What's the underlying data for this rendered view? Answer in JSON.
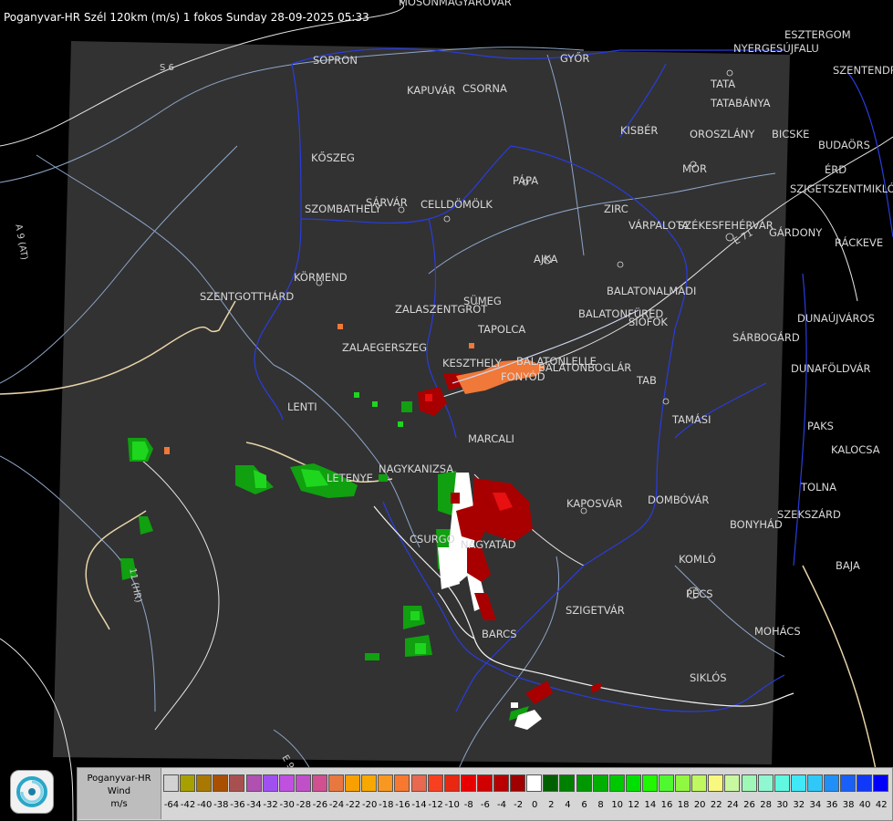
{
  "header": {
    "title": "Poganyvar-HR Szél 120km (m/s) 1 fokos Sunday 28-09-2025 05:33"
  },
  "cities": [
    {
      "name": "MOSONMAGYARÓVÁR"
    },
    {
      "name": "SOPRON"
    },
    {
      "name": "KAPUVÁR"
    },
    {
      "name": "CSORNA"
    },
    {
      "name": "GYŐR"
    },
    {
      "name": "ESZTERGOM"
    },
    {
      "name": "NYERGESÚJFALU"
    },
    {
      "name": "SZENTENDRE"
    },
    {
      "name": "TATA"
    },
    {
      "name": "TATABÁNYA"
    },
    {
      "name": "KISBÉR"
    },
    {
      "name": "OROSZLÁNY"
    },
    {
      "name": "BICSKE"
    },
    {
      "name": "BUDAÖRS"
    },
    {
      "name": "MÓR"
    },
    {
      "name": "ÉRD"
    },
    {
      "name": "SZIGETSZENTMIKLÓS"
    },
    {
      "name": "KŐSZEG"
    },
    {
      "name": "PÁPA"
    },
    {
      "name": "SZOMBATHELY"
    },
    {
      "name": "SÁRVÁR"
    },
    {
      "name": "CELLDÖMÖLK"
    },
    {
      "name": "ZIRC"
    },
    {
      "name": "VÁRPALOTA"
    },
    {
      "name": "SZÉKESFEHÉRVÁR"
    },
    {
      "name": "GÁRDONY"
    },
    {
      "name": "RÁCKEVE"
    },
    {
      "name": "AJKA"
    },
    {
      "name": "KÖRMEND"
    },
    {
      "name": "SZENTGOTTHÁRD"
    },
    {
      "name": "SÜMEG"
    },
    {
      "name": "BALATONALMÁDI"
    },
    {
      "name": "ZALASZENTGRÓT"
    },
    {
      "name": "BALATONFÜRED"
    },
    {
      "name": "SIÓFOK"
    },
    {
      "name": "DUNAÚJVÁROS"
    },
    {
      "name": "TAPOLCA"
    },
    {
      "name": "ZALAEGERSZEG"
    },
    {
      "name": "SÁRBOGÁRD"
    },
    {
      "name": "KESZTHELY"
    },
    {
      "name": "BALATONLELLE"
    },
    {
      "name": "BALATONBOGLÁR"
    },
    {
      "name": "FONYÓD"
    },
    {
      "name": "DUNAFÖLDVÁR"
    },
    {
      "name": "TAB"
    },
    {
      "name": "LENTI"
    },
    {
      "name": "TAMÁSI"
    },
    {
      "name": "PAKS"
    },
    {
      "name": "MARCALI"
    },
    {
      "name": "KALOCSA"
    },
    {
      "name": "NAGYKANIZSA"
    },
    {
      "name": "LETENYE"
    },
    {
      "name": "TOLNA"
    },
    {
      "name": "KAPOSVÁR"
    },
    {
      "name": "DOMBÓVÁR"
    },
    {
      "name": "SZEKSZÁRD"
    },
    {
      "name": "CSURGÓ"
    },
    {
      "name": "NAGYATÁD"
    },
    {
      "name": "BONYHÁD"
    },
    {
      "name": "KOMLÓ"
    },
    {
      "name": "BAJA"
    },
    {
      "name": "PÉCS"
    },
    {
      "name": "SZIGETVÁR"
    },
    {
      "name": "BARCS"
    },
    {
      "name": "MOHÁCS"
    },
    {
      "name": "SIKLÓS"
    }
  ],
  "roads": [
    {
      "name": "S 6"
    },
    {
      "name": "A 9 (AT)"
    },
    {
      "name": "E 71"
    },
    {
      "name": "11 (HR)"
    },
    {
      "name": "E 96"
    }
  ],
  "legend": {
    "title_line1": "Poganyvar-HR",
    "title_line2": "Wind",
    "unit": "m/s",
    "labels": [
      "-64",
      "-42",
      "-40",
      "-38",
      "-36",
      "-34",
      "-32",
      "-30",
      "-28",
      "-26",
      "-24",
      "-22",
      "-20",
      "-18",
      "-16",
      "-14",
      "-12",
      "-10",
      "-8",
      "-6",
      "-4",
      "-2",
      "0",
      "2",
      "4",
      "6",
      "8",
      "10",
      "12",
      "14",
      "16",
      "18",
      "20",
      "22",
      "24",
      "26",
      "28",
      "30",
      "32",
      "34",
      "36",
      "38",
      "40",
      "42"
    ],
    "colors": [
      "#d2d2d2",
      "#a8a000",
      "#a87800",
      "#a85000",
      "#a85050",
      "#b050b0",
      "#a050f0",
      "#c050e0",
      "#c050c8",
      "#d05090",
      "#e87840",
      "#f8a000",
      "#f8a800",
      "#f89820",
      "#f87830",
      "#e86850",
      "#f84020",
      "#e82810",
      "#e80000",
      "#d00000",
      "#b80000",
      "#a00000",
      "#ffffff",
      "#006000",
      "#008000",
      "#009800",
      "#00b000",
      "#00c800",
      "#00e000",
      "#20f800",
      "#50f830",
      "#90f840",
      "#c0f860",
      "#f8f880",
      "#c8f8a0",
      "#a0f8b8",
      "#90f8d0",
      "#60f8e0",
      "#40e8f8",
      "#30c8f8",
      "#2090f8",
      "#1860f8",
      "#1038f8",
      "#0000f8"
    ]
  }
}
